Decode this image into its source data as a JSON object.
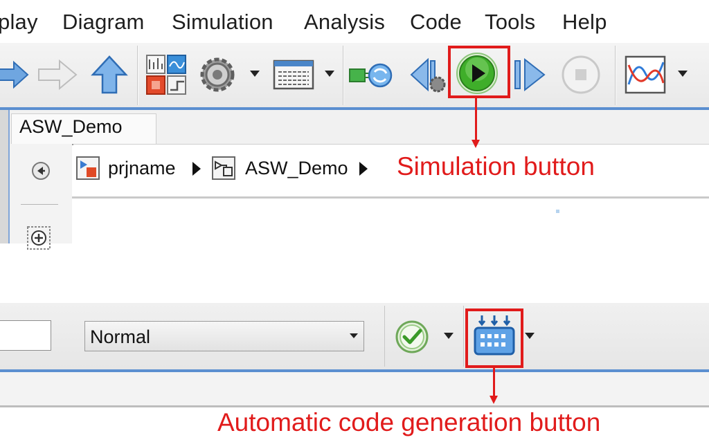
{
  "menu": {
    "items": [
      "play",
      "Diagram",
      "Simulation",
      "Analysis",
      "Code",
      "Tools",
      "Help"
    ]
  },
  "editor": {
    "tab_label": "ASW_Demo",
    "breadcrumb": [
      "prjname",
      "ASW_Demo"
    ]
  },
  "bottom_toolbar": {
    "mode_select_value": "Normal"
  },
  "annotations": {
    "simulation": "Simulation button",
    "codegen": "Automatic code generation button"
  },
  "colors": {
    "highlight": "#e11b1b",
    "accent_blue": "#5b8fd0",
    "run_green": "#3fae2a"
  },
  "icons": {
    "toolbar": [
      "back-arrow-icon",
      "forward-arrow-icon",
      "up-arrow-icon",
      "library-browser-icon",
      "settings-gear-icon",
      "model-explorer-icon",
      "update-diagram-icon",
      "step-back-icon",
      "run-simulation-icon",
      "step-forward-icon",
      "stop-icon",
      "data-inspector-icon"
    ],
    "bottom": [
      "check-icon",
      "code-generation-icon"
    ]
  }
}
